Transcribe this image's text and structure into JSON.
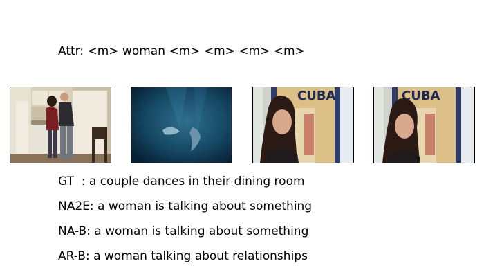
{
  "attr_line": "Attr: <m> woman <m> <m> <m> <m>",
  "frames": [
    {
      "icon": "couple-dancing-in-dining-room-icon"
    },
    {
      "icon": "underwater-dolphins-icon"
    },
    {
      "icon": "woman-with-cuba-poster-icon",
      "poster_text": "CUBA"
    },
    {
      "icon": "woman-with-cuba-poster-icon",
      "poster_text": "CUBA"
    }
  ],
  "captions": {
    "gt": "GT  : a couple dances in their dining room",
    "na2e": "NA2E: a woman is talking about something",
    "na_b": "NA-B: a woman is talking about something",
    "ar_b": "AR-B: a woman talking about relationships"
  },
  "colors": {
    "text": "#000000",
    "frame_border": "#000000",
    "background": "#ffffff"
  }
}
